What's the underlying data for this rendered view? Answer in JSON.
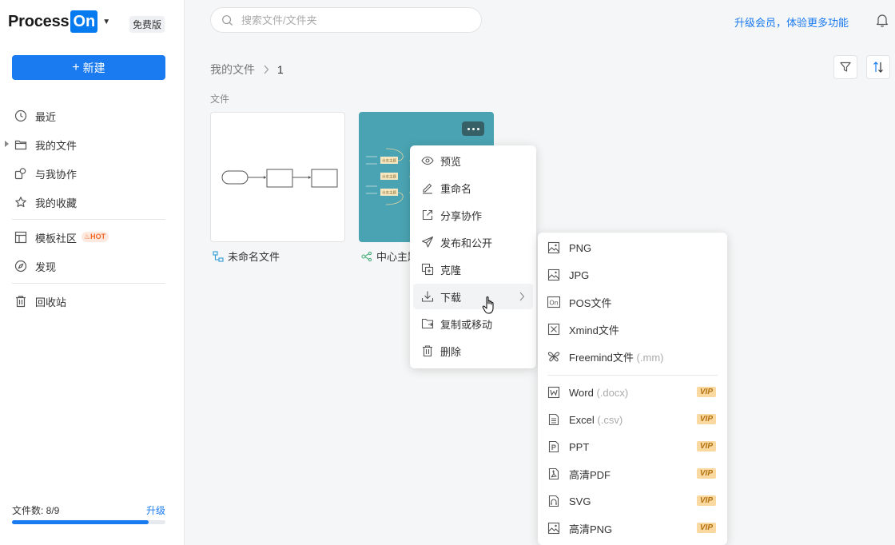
{
  "sidebar": {
    "logo_text": "Process",
    "logo_on": "On",
    "plan_badge": "免费版",
    "new_button": "新建",
    "nav": [
      {
        "label": "最近",
        "icon": "clock-icon"
      },
      {
        "label": "我的文件",
        "icon": "folder-icon"
      },
      {
        "label": "与我协作",
        "icon": "collaborate-icon"
      },
      {
        "label": "我的收藏",
        "icon": "star-icon"
      },
      {
        "label": "模板社区",
        "icon": "template-icon"
      },
      {
        "label": "发现",
        "icon": "compass-icon"
      },
      {
        "label": "回收站",
        "icon": "trash-icon"
      }
    ],
    "hot_badge": "HOT",
    "quota_label": "文件数: 8/9",
    "quota_fraction": 0.889,
    "quota_upgrade": "升级"
  },
  "header": {
    "search_placeholder": "搜索文件/文件夹",
    "upgrade_link": "升级会员，体验更多功能"
  },
  "main": {
    "breadcrumb": [
      "我的文件",
      "1"
    ],
    "section_label": "文件",
    "files": [
      {
        "title": "未命名文件",
        "type": "flowchart"
      },
      {
        "title": "中心主题",
        "type": "mindmap"
      }
    ],
    "mindmap_thumb_labels": [
      "分支主题",
      "分支主题",
      "分支主题"
    ]
  },
  "context_menu": {
    "items": [
      "预览",
      "重命名",
      "分享协作",
      "发布和公开",
      "克隆",
      "下载",
      "复制或移动",
      "删除"
    ],
    "active_index": 5
  },
  "download_menu": {
    "basic": [
      {
        "label": "PNG",
        "ext": ""
      },
      {
        "label": "JPG",
        "ext": ""
      },
      {
        "label": "POS文件",
        "ext": ""
      },
      {
        "label": "Xmind文件",
        "ext": ""
      },
      {
        "label": "Freemind文件",
        "ext": "(.mm)"
      }
    ],
    "vip": [
      {
        "label": "Word",
        "ext": "(.docx)"
      },
      {
        "label": "Excel",
        "ext": "(.csv)"
      },
      {
        "label": "PPT",
        "ext": ""
      },
      {
        "label": "高清PDF",
        "ext": ""
      },
      {
        "label": "SVG",
        "ext": ""
      },
      {
        "label": "高清PNG",
        "ext": ""
      }
    ],
    "vip_badge": "VIP",
    "pos_icon_text": "On"
  },
  "colors": {
    "accent": "#1a7af0",
    "mindmap_bg": "#4aa3b2",
    "vip_bg": "#fad9a0",
    "hot": "#f06a2a"
  }
}
